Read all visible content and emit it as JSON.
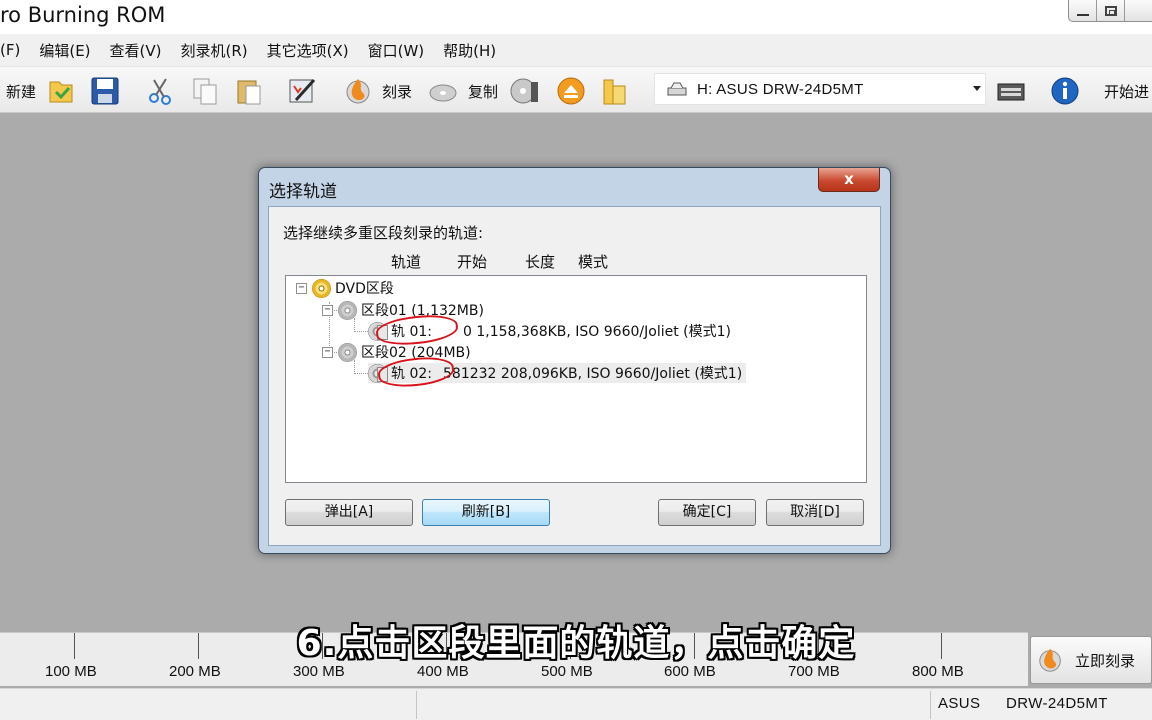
{
  "window": {
    "title": "ro Burning ROM"
  },
  "menu": [
    "(F)",
    "编辑(E)",
    "查看(V)",
    "刻录机(R)",
    "其它选项(X)",
    "窗口(W)",
    "帮助(H)"
  ],
  "toolbar": {
    "new_label": "新建",
    "burn_label": "刻录",
    "copy_label": "复制",
    "drive": "H: ASUS DRW-24D5MT",
    "start_label": "开始进"
  },
  "dialog": {
    "title": "选择轨道",
    "close": "x",
    "prompt": "选择继续多重区段刻录的轨道:",
    "columns": [
      "轨道",
      "开始",
      "长度",
      "模式"
    ],
    "tree": {
      "root": "DVD区段",
      "sessions": [
        {
          "label": "区段01 (1,132MB)",
          "track": "轨 01:",
          "track_info": "0 1,158,368KB, ISO 9660/Joliet (模式1)"
        },
        {
          "label": "区段02 (204MB)",
          "track": "轨 02:",
          "track_info": "581232 208,096KB, ISO 9660/Joliet (模式1)"
        }
      ]
    },
    "buttons": {
      "eject": "弹出[A]",
      "refresh": "刷新[B]",
      "ok": "确定[C]",
      "cancel": "取消[D]"
    }
  },
  "capacity_labels": [
    "100 MB",
    "200 MB",
    "300 MB",
    "400 MB",
    "500 MB",
    "600 MB",
    "700 MB",
    "800 MB"
  ],
  "burn_now": "立即刻录",
  "status": {
    "vendor": "ASUS",
    "model": "DRW-24D5MT"
  },
  "subtitle": "6.点击区段里面的轨道，点击确定",
  "colors": {
    "accent_red": "#d9131b",
    "dialog_frame": "#c3d4e7"
  }
}
